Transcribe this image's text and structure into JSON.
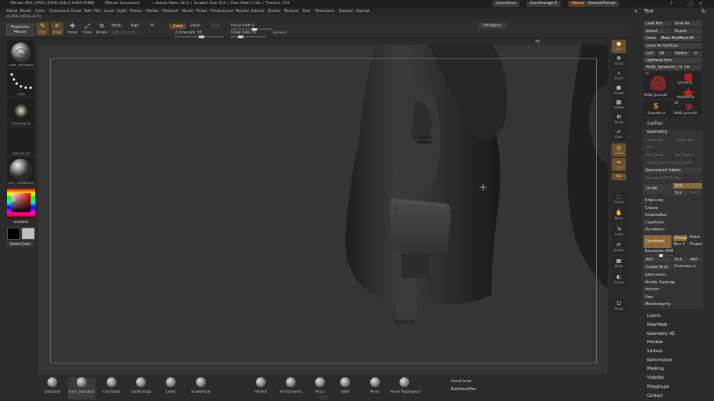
{
  "titlebar": {
    "app": "ZBrush 4R5 [VERG-Z3XD-QHLQ-AIW3-PSBB]",
    "document": "ZBrush Document",
    "mem_active": "• Active Mem 1814 • Scratch Disk 825 • Free Mem 1294 • Timer▸1.274",
    "quicksave": "QuickSave",
    "seethrough": "See-through  0",
    "menus_btn": "Menus",
    "default_script": "DefaultZScript"
  },
  "menubar": [
    "Alpha",
    "Brush",
    "Color",
    "Document",
    "Draw",
    "Edit",
    "File",
    "Layer",
    "Light",
    "Macro",
    "Marker",
    "Material",
    "Movie",
    "Picker",
    "Preferences",
    "Render",
    "Stencil",
    "Stroke",
    "Texture",
    "Tool",
    "Transform",
    "Zplugin",
    "Zscript"
  ],
  "coords": "-0.204,0.824,-0.31",
  "toolbar": {
    "projection_master": "Projection\nMaster",
    "icons": [
      {
        "label": "Edit",
        "icon": "pencil-icon",
        "active": true
      },
      {
        "label": "Draw",
        "icon": "brush-icon",
        "active": true
      },
      {
        "label": "Move",
        "icon": "move-icon",
        "active": false
      },
      {
        "label": "Scale",
        "icon": "scale-icon",
        "active": false
      },
      {
        "label": "Rotate",
        "icon": "rotate-icon",
        "active": false
      }
    ],
    "mrgb": "Mrgb",
    "rgb": "Rgb",
    "m": "M",
    "rgb_intensity": "Rgb Intensity",
    "zadd": "Zadd",
    "zsub": "Zsub",
    "zcut": "Zcut",
    "z_intensity": "Z Intensity 33",
    "focal_shift": "Focal Shift 0",
    "draw_size": "Draw Size 25",
    "dynamic": "Dynamic",
    "fill_object": "FillObject"
  },
  "lefttray": {
    "brush_label": "Dam_Standard",
    "stroke_label": "Dots",
    "alpha_label": "BrushAlpha",
    "texture_label": "Texture Off",
    "material_label": "Skin_ShadeSkin",
    "gradient": "Gradient",
    "switch_color": "SwitchColor"
  },
  "rightshelf": [
    {
      "label": "Spix",
      "icon": "spix-icon",
      "active": true
    },
    {
      "label": "Scroll",
      "icon": "scroll-icon",
      "active": false
    },
    {
      "label": "Zoom",
      "icon": "zoom-icon",
      "active": false
    },
    {
      "label": "Actual",
      "icon": "actual-icon",
      "active": false
    },
    {
      "label": "AAHalf",
      "icon": "aahalf-icon",
      "active": false
    },
    {
      "label": "Persp",
      "icon": "persp-icon",
      "active": false
    },
    {
      "label": "Floor",
      "icon": "floor-icon",
      "active": false
    },
    {
      "label": "Local",
      "icon": "local-icon",
      "active": true
    },
    {
      "label": "L.Sym",
      "icon": "lsym-icon",
      "active": true
    },
    {
      "label": "Xyz",
      "icon": "xyz-icon",
      "active": true
    },
    {
      "label": "Frame",
      "icon": "frame-icon",
      "active": false
    },
    {
      "label": "Move",
      "icon": "move-icon",
      "active": false
    },
    {
      "label": "Scale",
      "icon": "scale-icon",
      "active": false
    },
    {
      "label": "Rotate",
      "icon": "rotate-icon",
      "active": false
    },
    {
      "label": "PolyF",
      "icon": "polyf-icon",
      "active": false
    },
    {
      "label": "Transp",
      "icon": "transp-icon",
      "active": false
    },
    {
      "label": "Ghost",
      "icon": "ghost-icon",
      "active": false
    }
  ],
  "palette": {
    "title": "Tool",
    "load_tool": "Load Tool",
    "save_as": "Save As",
    "import": "Import",
    "export": "Export",
    "clone": "Clone",
    "make_polymesh": "Make PolyMesh3D",
    "clone_all": "Clone All SubTools",
    "goz": "GoZ",
    "all": "All",
    "visible": "Visible",
    "r": "R",
    "lightbox_tools": "Lightbox▸Tools",
    "current_tool": "PM3D_Sphere3D_13. 48",
    "thumb_count": "15",
    "thumbs": [
      "PM3D_Sphere3D",
      "Cylinder3D",
      "PolyMesh3D",
      "SimpleBrush",
      "PM3D_Sphere3D"
    ],
    "thumb_count2": "14",
    "subtool": "SubTool",
    "geometry": "Geometry",
    "lower_res": "Lower Res",
    "higher_res": "Higher Res",
    "sdiv": "SDiv",
    "del_lower": "Del Lower",
    "del_higher": "Del Higher",
    "freeze_subdiv": "Freeze SubDivision Levels",
    "reconstruct_subdiv": "Reconstruct Subdiv",
    "convert_bpr": "Convert BPR To Geo",
    "divide": "Divide",
    "smt": "Smt",
    "suv": "Suv",
    "relax": "ReUV",
    "edgeloop": "EdgeLoop",
    "crease": "Crease",
    "shadowbox": "ShadowBox",
    "claypolish": "ClayPolish",
    "dynamesh": "DynaMesh",
    "dynamesh_btn": "DynaMesh",
    "groups": "Groups",
    "polish": "Polish",
    "blur": "Blur 2",
    "project": "Project",
    "resolution": "Resolution 608",
    "add": "Add",
    "sub": "Sub",
    "and": "And",
    "create_shell": "Create Shell",
    "thickness": "Thickness 4",
    "qremesher": "qRemesher",
    "modify_topology": "Modify Topology",
    "position": "Position",
    "size": "Size",
    "meshintegrity": "MeshIntegrity",
    "sections": [
      "Layers",
      "FiberMesh",
      "Geometry HD",
      "Preview",
      "Surface",
      "Deformation",
      "Masking",
      "Visibility",
      "Polygroups",
      "Contact"
    ]
  },
  "bottomshelf": [
    {
      "label": "Standard",
      "active": false
    },
    {
      "label": "Dam_Standard",
      "active": true
    },
    {
      "label": "ClayTubes",
      "active": false
    },
    {
      "label": "ClayBuildup",
      "active": false
    },
    {
      "label": "Layer",
      "active": false
    },
    {
      "label": "SnakeHook",
      "active": false
    },
    {
      "label": "hPolish",
      "active": false
    },
    {
      "label": "TrimDynamic",
      "active": false
    },
    {
      "label": "Pinch",
      "active": false
    },
    {
      "label": "Inflat",
      "active": false
    },
    {
      "label": "Move",
      "active": false
    },
    {
      "label": "Move Topological",
      "active": false
    }
  ],
  "accucurve": "AccuCurve",
  "backfacemask": "BackfaceMas"
}
